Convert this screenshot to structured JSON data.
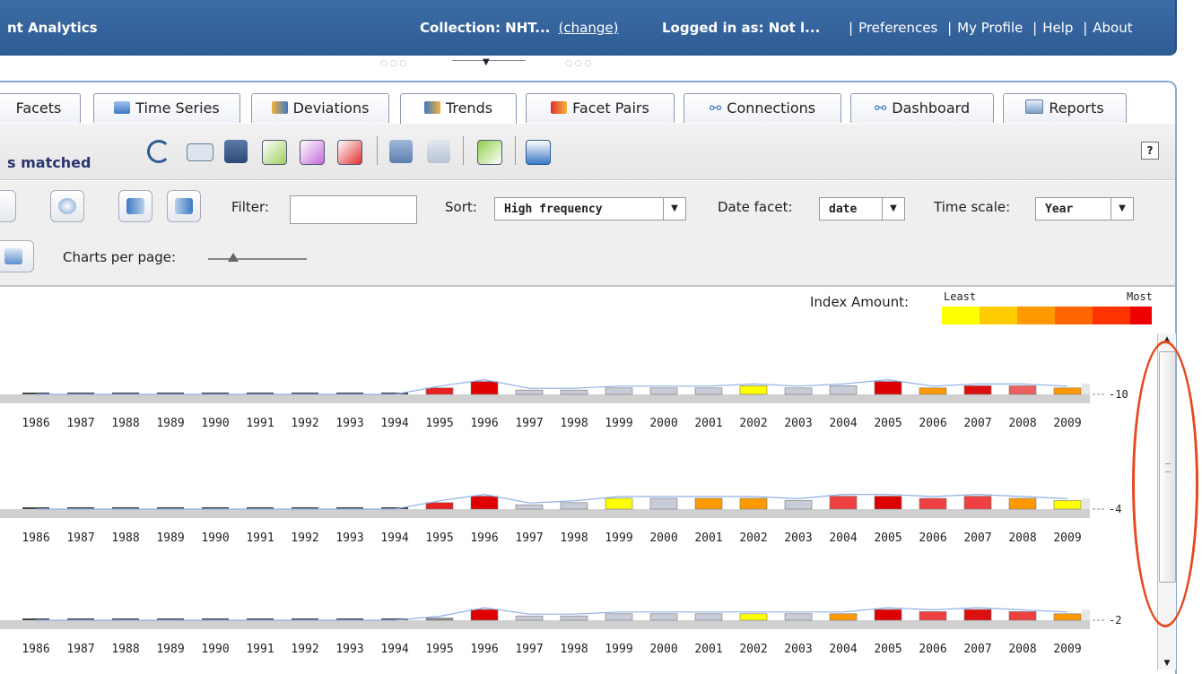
{
  "header": {
    "app_title": "nt Analytics",
    "collection_label": "Collection: NHT...",
    "change_link": "(change)",
    "logged_in": "Logged in as: Not l...",
    "links": [
      "Preferences",
      "My Profile",
      "Help",
      "About"
    ]
  },
  "tabs": [
    {
      "label": "Facets",
      "icon": "facets-icon"
    },
    {
      "label": "Time Series",
      "icon": "time-series-icon"
    },
    {
      "label": "Deviations",
      "icon": "deviations-icon"
    },
    {
      "label": "Trends",
      "icon": "trends-icon",
      "active": true
    },
    {
      "label": "Facet Pairs",
      "icon": "facet-pairs-icon"
    },
    {
      "label": "Connections",
      "icon": "connections-icon"
    },
    {
      "label": "Dashboard",
      "icon": "dashboard-icon"
    },
    {
      "label": "Reports",
      "icon": "reports-icon"
    }
  ],
  "toolbar": {
    "matched_text": "s matched",
    "help_label": "?"
  },
  "controls": {
    "filter_label": "Filter:",
    "filter_value": "",
    "sort_label": "Sort:",
    "sort_value": "High frequency",
    "date_facet_label": "Date facet:",
    "date_facet_value": "date",
    "time_scale_label": "Time scale:",
    "time_scale_value": "Year",
    "charts_per_page_label": "Charts per page:"
  },
  "legend": {
    "title": "Index Amount:",
    "least": "Least",
    "most": "Most",
    "colors": [
      "#ffff00",
      "#ffcc00",
      "#ff9900",
      "#ff6600",
      "#ff3300",
      "#ee0000"
    ]
  },
  "chart_data": [
    {
      "type": "bar",
      "categories": [
        "1986",
        "1987",
        "1988",
        "1989",
        "1990",
        "1991",
        "1992",
        "1993",
        "1994",
        "1995",
        "1996",
        "1997",
        "1998",
        "1999",
        "2000",
        "2001",
        "2002",
        "2003",
        "2004",
        "2005",
        "2006",
        "2007",
        "2008",
        "2009"
      ],
      "axis_value_label": "-10",
      "values": [
        0,
        0,
        0,
        0,
        0,
        0,
        0,
        0,
        0,
        3,
        6,
        2,
        2,
        3,
        3,
        3,
        4,
        3,
        4,
        6,
        3,
        4,
        4,
        3
      ],
      "colors": [
        "#444",
        "#444",
        "#444",
        "#444",
        "#444",
        "#444",
        "#444",
        "#444",
        "#444",
        "#e82020",
        "#e00000",
        "#c8ccd8",
        "#c8ccd8",
        "#c8ccd8",
        "#c8ccd8",
        "#c8ccd8",
        "#ffff00",
        "#c8ccd8",
        "#c8ccd8",
        "#dd0000",
        "#ff9900",
        "#dd1010",
        "#ee6060",
        "#ff9900"
      ]
    },
    {
      "type": "bar",
      "categories": [
        "1986",
        "1987",
        "1988",
        "1989",
        "1990",
        "1991",
        "1992",
        "1993",
        "1994",
        "1995",
        "1996",
        "1997",
        "1998",
        "1999",
        "2000",
        "2001",
        "2002",
        "2003",
        "2004",
        "2005",
        "2006",
        "2007",
        "2008",
        "2009"
      ],
      "axis_value_label": "-4",
      "values": [
        0,
        0,
        0,
        0,
        0,
        0,
        0,
        0,
        0,
        3,
        6,
        2,
        3,
        5,
        5,
        5,
        5,
        4,
        6,
        6,
        5,
        6,
        5,
        4
      ],
      "colors": [
        "#444",
        "#444",
        "#444",
        "#444",
        "#444",
        "#444",
        "#444",
        "#444",
        "#444",
        "#e82020",
        "#e00000",
        "#c8ccd8",
        "#c8ccd8",
        "#ffff00",
        "#c8ccd8",
        "#ff9900",
        "#ff9900",
        "#c8ccd8",
        "#ee4040",
        "#dd0000",
        "#ee4040",
        "#ee4040",
        "#ff9900",
        "#ffff00"
      ]
    },
    {
      "type": "bar",
      "categories": [
        "1986",
        "1987",
        "1988",
        "1989",
        "1990",
        "1991",
        "1992",
        "1993",
        "1994",
        "1995",
        "1996",
        "1997",
        "1998",
        "1999",
        "2000",
        "2001",
        "2002",
        "2003",
        "2004",
        "2005",
        "2006",
        "2007",
        "2008",
        "2009"
      ],
      "axis_value_label": "-2",
      "values": [
        0,
        0,
        0,
        0,
        0,
        0,
        0,
        0,
        0,
        1,
        5,
        2,
        2,
        3,
        3,
        3,
        3,
        3,
        3,
        5,
        4,
        5,
        4,
        3
      ],
      "colors": [
        "#444",
        "#444",
        "#444",
        "#444",
        "#444",
        "#444",
        "#444",
        "#444",
        "#444",
        "#888",
        "#e00000",
        "#c8ccd8",
        "#c8ccd8",
        "#c8ccd8",
        "#c8ccd8",
        "#c8ccd8",
        "#ffff00",
        "#c8ccd8",
        "#ff9900",
        "#dd0000",
        "#ee4040",
        "#dd1010",
        "#ee4040",
        "#ff9900"
      ]
    }
  ]
}
